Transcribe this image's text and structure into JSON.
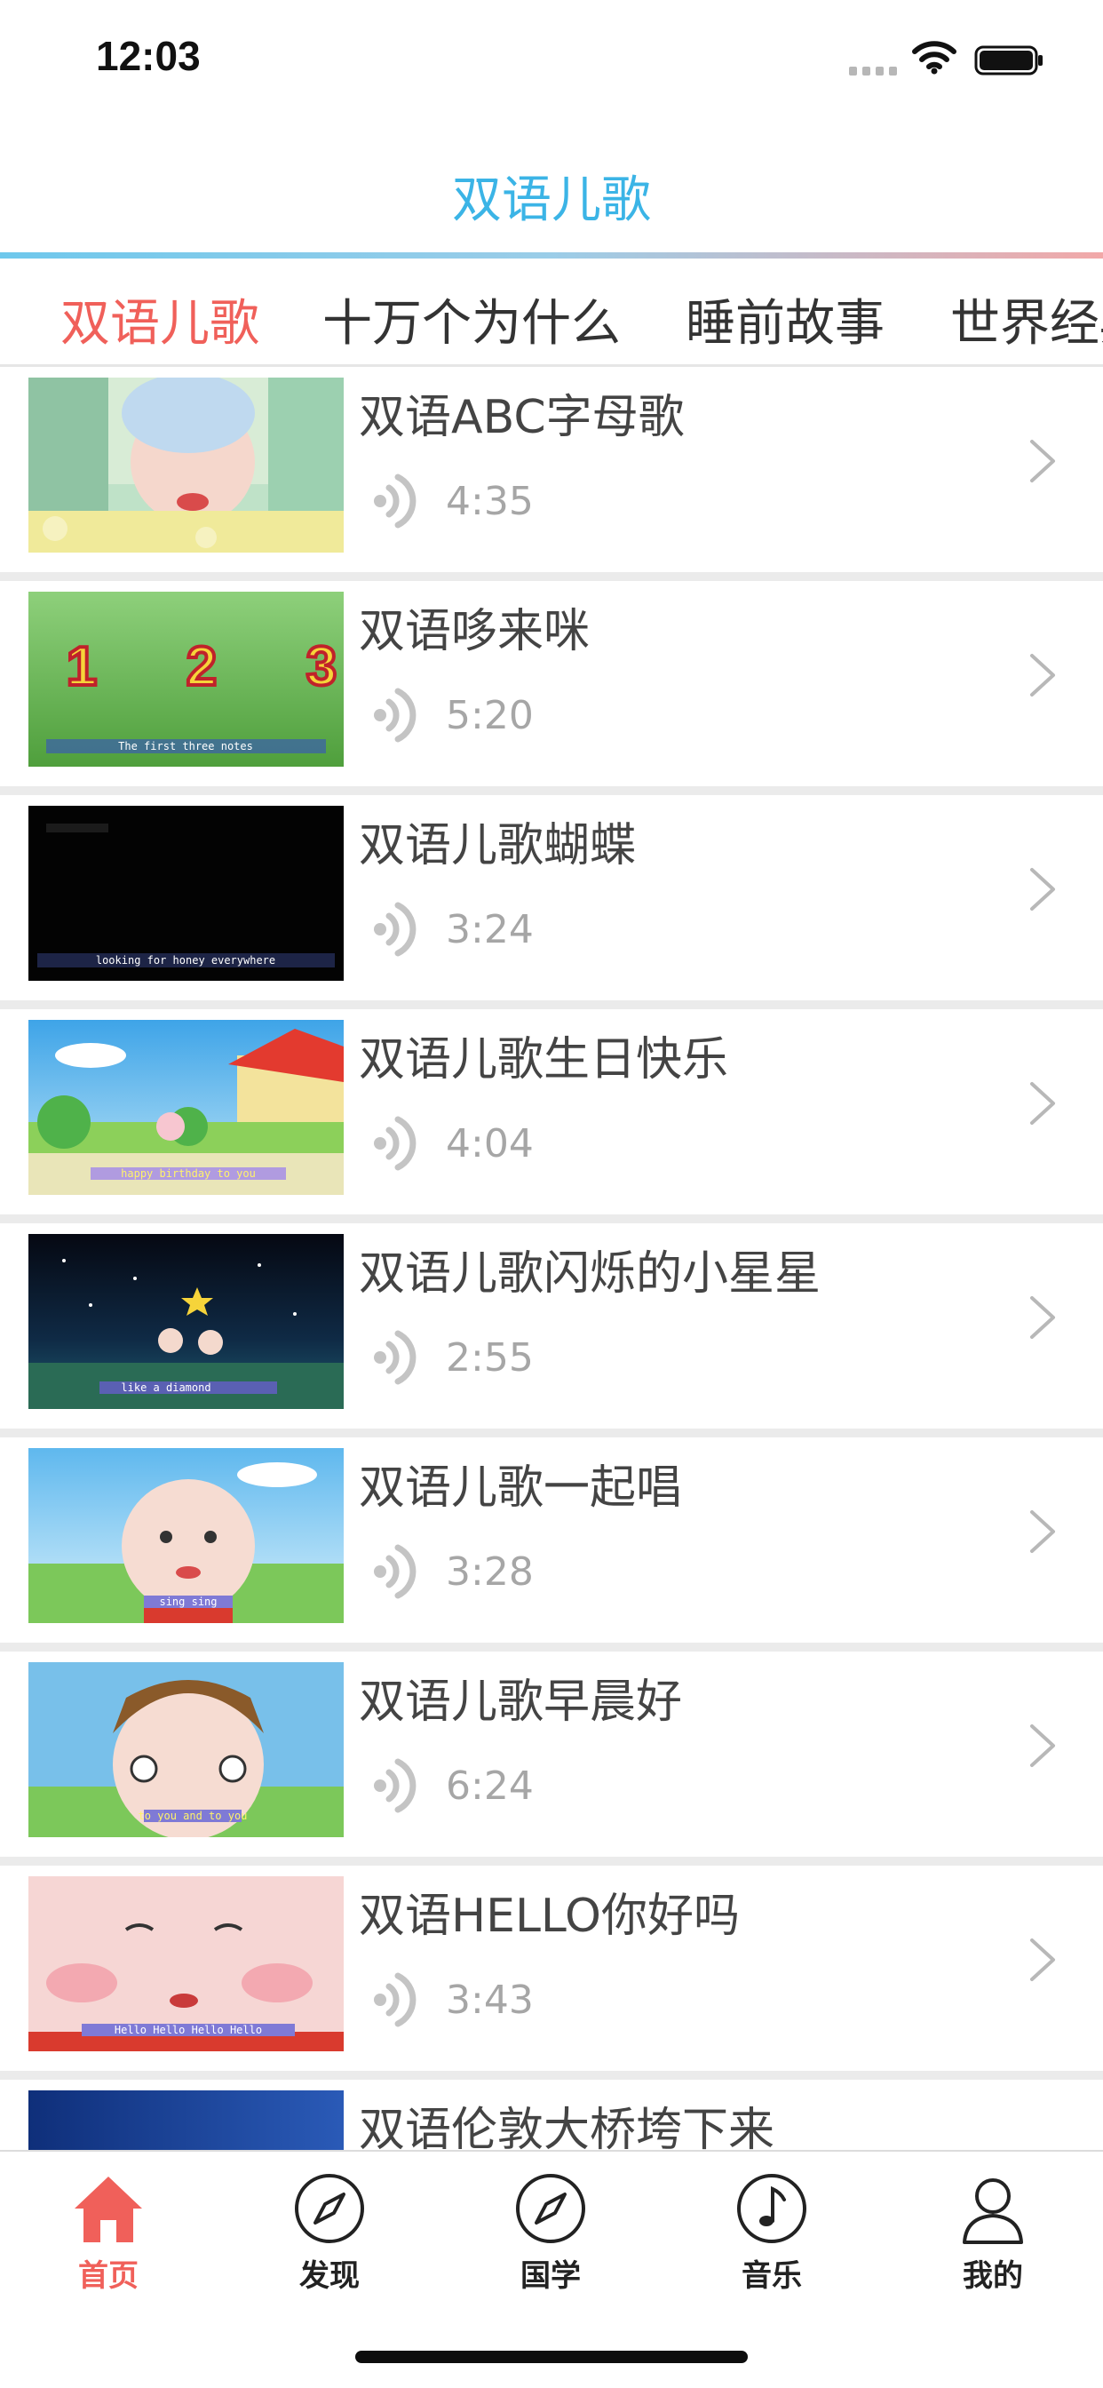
{
  "status_bar": {
    "time": "12:03"
  },
  "header": {
    "title": "双语儿歌"
  },
  "tabs": [
    {
      "label": "双语儿歌",
      "active": true
    },
    {
      "label": "十万个为什么",
      "active": false
    },
    {
      "label": "睡前故事",
      "active": false
    },
    {
      "label": "世界经典",
      "active": false
    }
  ],
  "songs": [
    {
      "title": "双语ABC字母歌",
      "duration": "4:35"
    },
    {
      "title": "双语哆来咪",
      "duration": "5:20",
      "caption": "The first three notes"
    },
    {
      "title": "双语儿歌蝴蝶",
      "duration": "3:24",
      "caption": "looking for honey everywhere"
    },
    {
      "title": "双语儿歌生日快乐",
      "duration": "4:04",
      "caption": "happy birthday to you"
    },
    {
      "title": "双语儿歌闪烁的小星星",
      "duration": "2:55",
      "caption": "like a diamond"
    },
    {
      "title": "双语儿歌一起唱",
      "duration": "3:28",
      "caption": "sing sing"
    },
    {
      "title": "双语儿歌早晨好",
      "duration": "6:24",
      "caption": "to you and to you"
    },
    {
      "title": "双语HELLO你好吗",
      "duration": "3:43",
      "caption": "Hello Hello Hello Hello"
    },
    {
      "title": "双语伦敦大桥垮下来",
      "duration": ""
    }
  ],
  "thumb_numbers": [
    "1",
    "2",
    "3"
  ],
  "tabbar": [
    {
      "label": "首页",
      "icon": "home-icon",
      "active": true
    },
    {
      "label": "发现",
      "icon": "compass-icon",
      "active": false
    },
    {
      "label": "国学",
      "icon": "compass-icon",
      "active": false
    },
    {
      "label": "音乐",
      "icon": "music-note-icon",
      "active": false
    },
    {
      "label": "我的",
      "icon": "person-icon",
      "active": false
    }
  ],
  "colors": {
    "accent_blue": "#3bb4e6",
    "accent_red": "#f0605a",
    "duration_gray": "#a6a6a6"
  }
}
